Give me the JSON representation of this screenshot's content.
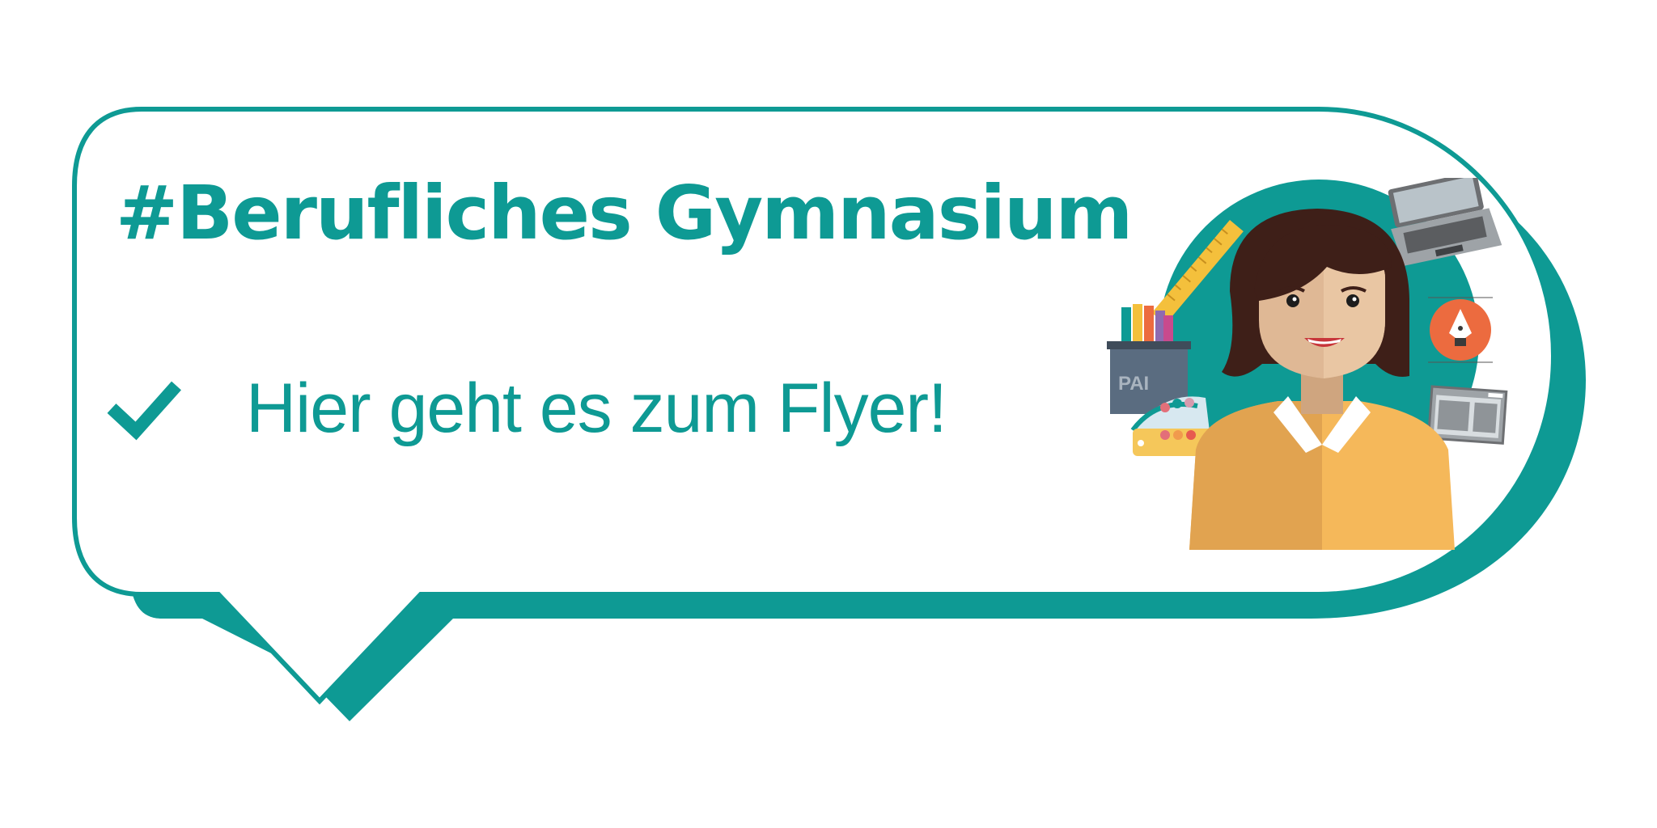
{
  "colors": {
    "accent": "#0e9a94",
    "border": "#0e9a94",
    "shadow": "#0e9a94",
    "background": "#ffffff",
    "shirt": "#eda94f",
    "skin": "#dfb895",
    "hair": "#3e1f18",
    "ruler": "#f4c03c",
    "pen_tool": "#ec6b3f"
  },
  "banner": {
    "headline": "#Berufliches Gymnasium",
    "cta_label": "Hier geht es zum Flyer!",
    "check_icon": "check-icon"
  },
  "illustration": {
    "icons": [
      "ruler-icon",
      "laptop-icon",
      "pen-tool-icon",
      "browser-window-icon",
      "paint-bucket-icon",
      "color-swatch-icon"
    ],
    "paint_label": "PAI"
  }
}
